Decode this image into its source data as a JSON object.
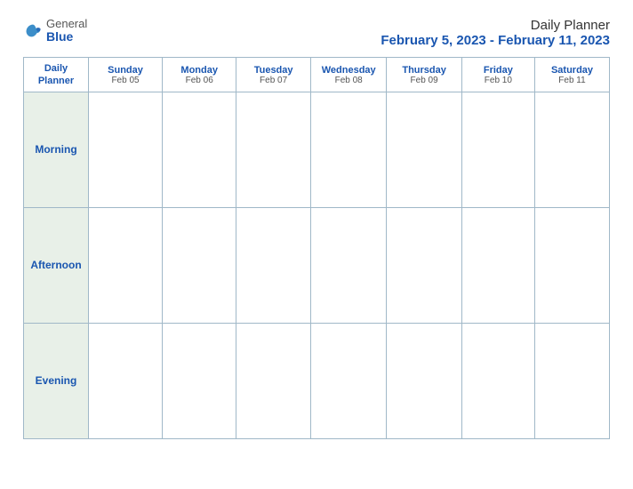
{
  "logo": {
    "general": "General",
    "blue": "Blue"
  },
  "header": {
    "title": "Daily Planner",
    "date_range": "February 5, 2023 - February 11, 2023"
  },
  "table": {
    "label_header_line1": "Daily",
    "label_header_line2": "Planner",
    "days": [
      {
        "name": "Sunday",
        "date": "Feb 05"
      },
      {
        "name": "Monday",
        "date": "Feb 06"
      },
      {
        "name": "Tuesday",
        "date": "Feb 07"
      },
      {
        "name": "Wednesday",
        "date": "Feb 08"
      },
      {
        "name": "Thursday",
        "date": "Feb 09"
      },
      {
        "name": "Friday",
        "date": "Feb 10"
      },
      {
        "name": "Saturday",
        "date": "Feb 11"
      }
    ],
    "rows": [
      {
        "label": "Morning"
      },
      {
        "label": "Afternoon"
      },
      {
        "label": "Evening"
      }
    ]
  }
}
